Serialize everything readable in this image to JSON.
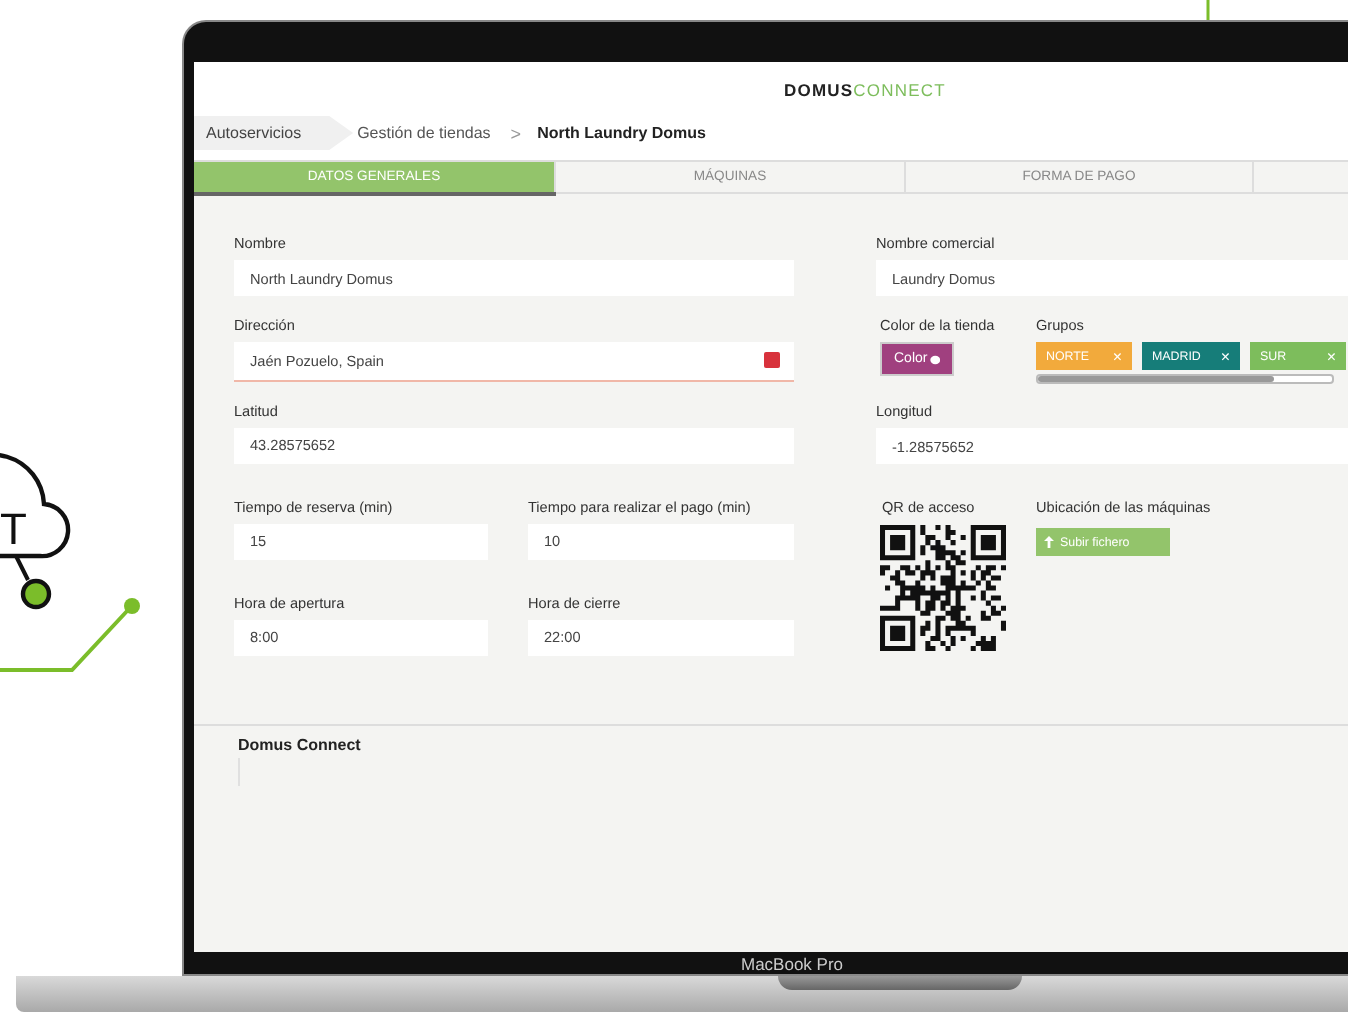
{
  "decoration": {
    "cloud_text": "T"
  },
  "logo": {
    "brand": "DOMUS",
    "suffix": "CONNECT"
  },
  "breadcrumb": [
    {
      "label": "Autoservicios",
      "kind": "chip"
    },
    {
      "label": "Gestión de tiendas",
      "kind": "link"
    },
    {
      "label": ">",
      "kind": "separator"
    },
    {
      "label": "North Laundry Domus",
      "kind": "current"
    }
  ],
  "tabs": [
    {
      "label": "DATOS GENERALES",
      "selected": true
    },
    {
      "label": "MÁQUINAS",
      "selected": false
    },
    {
      "label": "FORMA DE PAGO",
      "selected": false
    }
  ],
  "left_fields": [
    {
      "label": "Nombre",
      "value": "North Laundry Domus",
      "kind": "text"
    },
    {
      "label": "Dirección",
      "value": "Jaén Pozuelo, Spain",
      "kind": "error"
    },
    {
      "label": "Latitud",
      "value": "43.28575652",
      "kind": "text"
    }
  ],
  "time_rows": [
    [
      {
        "label": "Tiempo de reserva (min)",
        "value": "15"
      },
      {
        "label": "Tiempo para realizar el pago (min)",
        "value": "10"
      }
    ],
    [
      {
        "label": "Hora de apertura",
        "value": "8:00"
      },
      {
        "label": "Hora de cierre",
        "value": "22:00"
      }
    ]
  ],
  "trade_name": {
    "label": "Nombre comercial",
    "value": "Laundry Domus"
  },
  "store_color": {
    "label": "Color de la tienda",
    "button": "Color",
    "color": "#a0407f"
  },
  "groups": {
    "label": "Grupos",
    "tags": [
      {
        "label": "NORTE",
        "remove": "×",
        "color": "#f2aa3c"
      },
      {
        "label": "MADRID",
        "remove": "×",
        "color": "#167d79"
      },
      {
        "label": "SUR",
        "remove": "×",
        "color": "#7dbd5c"
      }
    ]
  },
  "longitude": {
    "label": "Longitud",
    "value": "-1.28575652"
  },
  "qr": {
    "label": "QR de acceso"
  },
  "machine_location": {
    "label": "Ubicación de las máquinas",
    "button": "Subir fichero"
  },
  "footer": {
    "title": "Domus Connect"
  },
  "device": {
    "label": "MacBook Pro"
  }
}
